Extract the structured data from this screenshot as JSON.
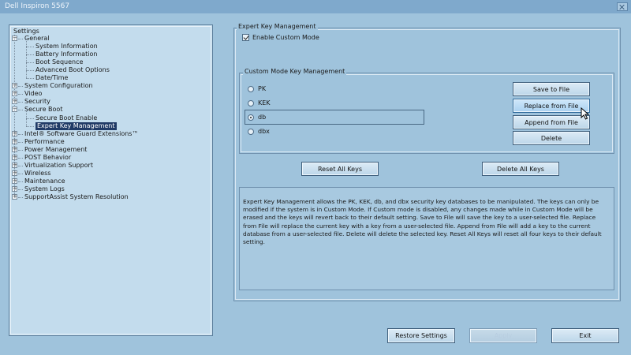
{
  "window": {
    "title": "Dell Inspiron 5567"
  },
  "tree": {
    "root_label": "Settings",
    "items": [
      {
        "label": "General",
        "level": 0,
        "expander": "−"
      },
      {
        "label": "System Information",
        "level": 1
      },
      {
        "label": "Battery Information",
        "level": 1
      },
      {
        "label": "Boot Sequence",
        "level": 1
      },
      {
        "label": "Advanced Boot Options",
        "level": 1
      },
      {
        "label": "Date/Time",
        "level": 1
      },
      {
        "label": "System Configuration",
        "level": 0,
        "expander": "+"
      },
      {
        "label": "Video",
        "level": 0,
        "expander": "+"
      },
      {
        "label": "Security",
        "level": 0,
        "expander": "+"
      },
      {
        "label": "Secure Boot",
        "level": 0,
        "expander": "−"
      },
      {
        "label": "Secure Boot Enable",
        "level": 1
      },
      {
        "label": "Expert Key Management",
        "level": 1,
        "selected": true
      },
      {
        "label": "Intel® Software Guard Extensions™",
        "level": 0,
        "expander": "+"
      },
      {
        "label": "Performance",
        "level": 0,
        "expander": "+"
      },
      {
        "label": "Power Management",
        "level": 0,
        "expander": "+"
      },
      {
        "label": "POST Behavior",
        "level": 0,
        "expander": "+"
      },
      {
        "label": "Virtualization Support",
        "level": 0,
        "expander": "+"
      },
      {
        "label": "Wireless",
        "level": 0,
        "expander": "+"
      },
      {
        "label": "Maintenance",
        "level": 0,
        "expander": "+"
      },
      {
        "label": "System Logs",
        "level": 0,
        "expander": "+"
      },
      {
        "label": "SupportAssist System Resolution",
        "level": 0,
        "expander": "+"
      }
    ]
  },
  "ekm": {
    "group_title": "Expert Key Management",
    "enable_custom_mode_label": "Enable Custom Mode",
    "enable_custom_mode_checked": true,
    "custom_group_title": "Custom Mode Key Management",
    "keys": [
      {
        "label": "PK",
        "selected": false
      },
      {
        "label": "KEK",
        "selected": false
      },
      {
        "label": "db",
        "selected": true
      },
      {
        "label": "dbx",
        "selected": false
      }
    ],
    "buttons": {
      "save_to_file": "Save to File",
      "replace_from_file": "Replace from File",
      "append_from_file": "Append from File",
      "delete": "Delete",
      "reset_all_keys": "Reset All Keys",
      "delete_all_keys": "Delete All Keys"
    },
    "description": "Expert Key Management allows the PK, KEK, db, and dbx security key databases to be manipulated. The keys can only be modified if the system is in Custom Mode. If Custom mode is disabled, any changes made while in Custom Mode will be erased and the keys will revert back to their default setting. Save to File will save the key to a user-selected file. Replace from File will replace the current key with a key from a user-selected file. Append from File will add a key to the current database from a user-selected file. Delete will delete the selected key. Reset All Keys will reset all four keys to their default setting."
  },
  "footer": {
    "restore_settings": "Restore Settings",
    "apply": "Apply",
    "exit": "Exit"
  },
  "colors": {
    "background": "#9fc3dc",
    "selection": "#203a66",
    "titlebar": "#7fa9cc"
  }
}
